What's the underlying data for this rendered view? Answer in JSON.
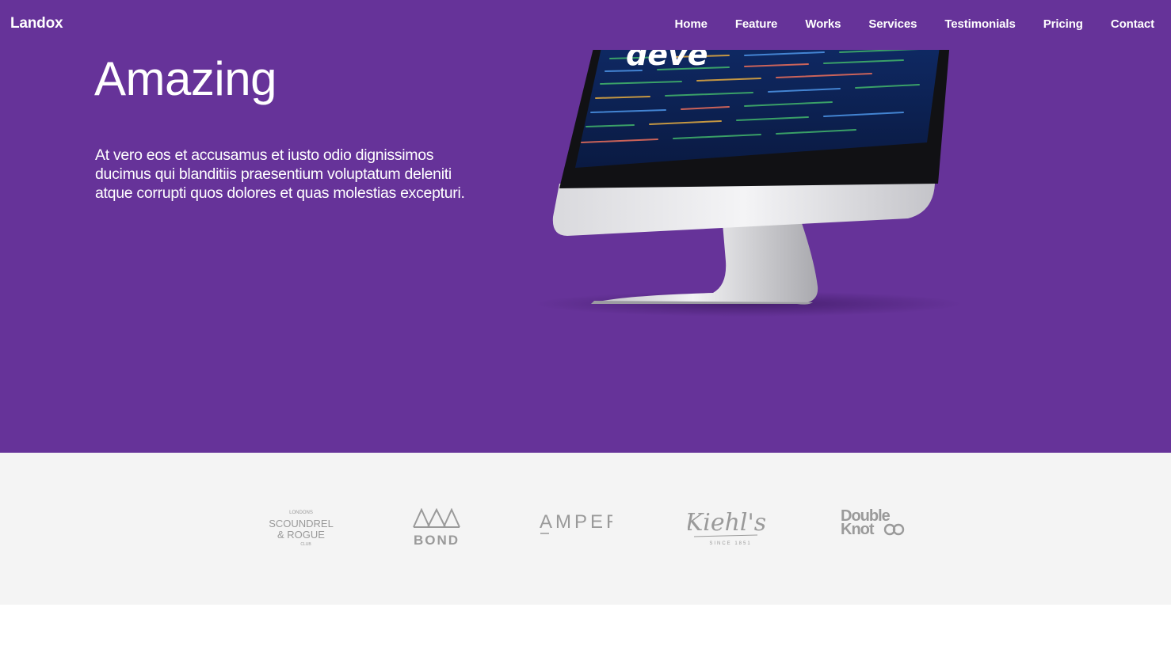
{
  "brand": "Landox",
  "nav": {
    "items": [
      "Home",
      "Feature",
      "Works",
      "Services",
      "Testimonials",
      "Pricing",
      "Contact"
    ]
  },
  "hero": {
    "title": "Amazing",
    "text": "At vero eos et accusamus et iusto odio dignissimos ducimus qui blanditiis praesentium voluptatum deleniti atque corrupti quos dolores et quas molestias excepturi.",
    "screen_word": "deve"
  },
  "clients": {
    "logos": [
      {
        "name": "scoundrel-rogue",
        "lines": [
          "LONDONS",
          "SCOUNDREL",
          "& ROGUE",
          "CLUB"
        ]
      },
      {
        "name": "bond",
        "lines": [
          "BOND"
        ]
      },
      {
        "name": "ampere",
        "lines": [
          "AMPERE"
        ]
      },
      {
        "name": "kiehls",
        "lines": [
          "Kiehl's",
          "SINCE 1851"
        ]
      },
      {
        "name": "double-knot",
        "lines": [
          "Double",
          "Knot"
        ]
      }
    ]
  },
  "colors": {
    "hero_bg": "#663399",
    "logos_bg": "#f4f4f4",
    "logo_gray": "#9a9a9a",
    "text": "#ffffff"
  }
}
